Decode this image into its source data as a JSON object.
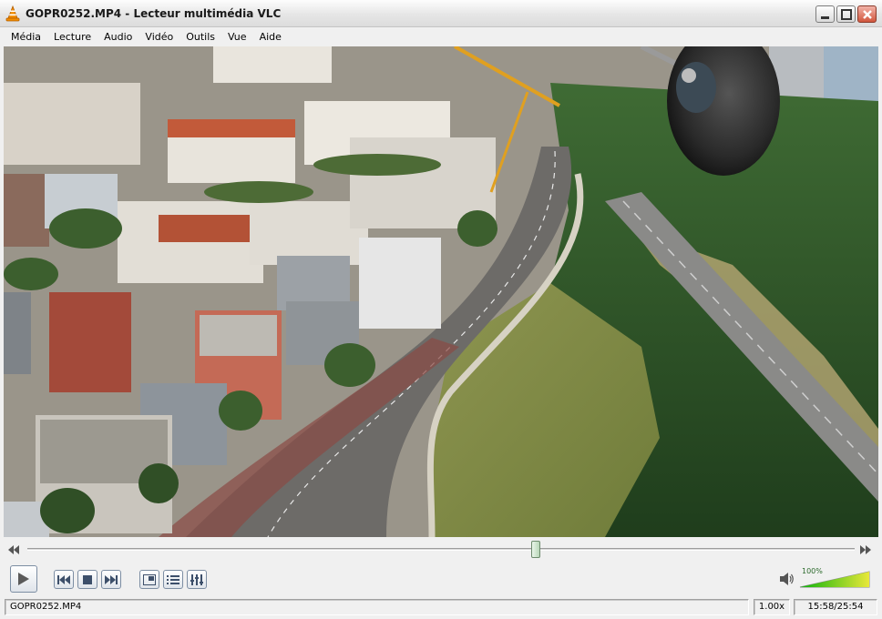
{
  "window": {
    "title": "GOPR0252.MP4 - Lecteur multimédia VLC",
    "buttons": {
      "minimize": "minimize-icon",
      "maximize": "maximize-icon",
      "close": "close-icon"
    }
  },
  "menu": [
    "Média",
    "Lecture",
    "Audio",
    "Vidéo",
    "Outils",
    "Vue",
    "Aide"
  ],
  "video": {
    "content": "aerial-city-photo"
  },
  "seek": {
    "position": 0.614
  },
  "controls": {
    "play": "play-icon",
    "previous": "previous-icon",
    "stop": "stop-icon",
    "next": "next-icon",
    "fullscreen": "fullscreen-icon",
    "playlist": "playlist-icon",
    "extended": "equalizer-icon"
  },
  "volume": {
    "label": "100%",
    "level": 1.0,
    "icon": "speaker-icon"
  },
  "status": {
    "filename": "GOPR0252.MP4",
    "speed": "1.00x",
    "time": "15:58/25:54"
  },
  "colors": {
    "accent": "#f28c00",
    "volume_start": "#0bb30b",
    "volume_end": "#e8e83a"
  }
}
